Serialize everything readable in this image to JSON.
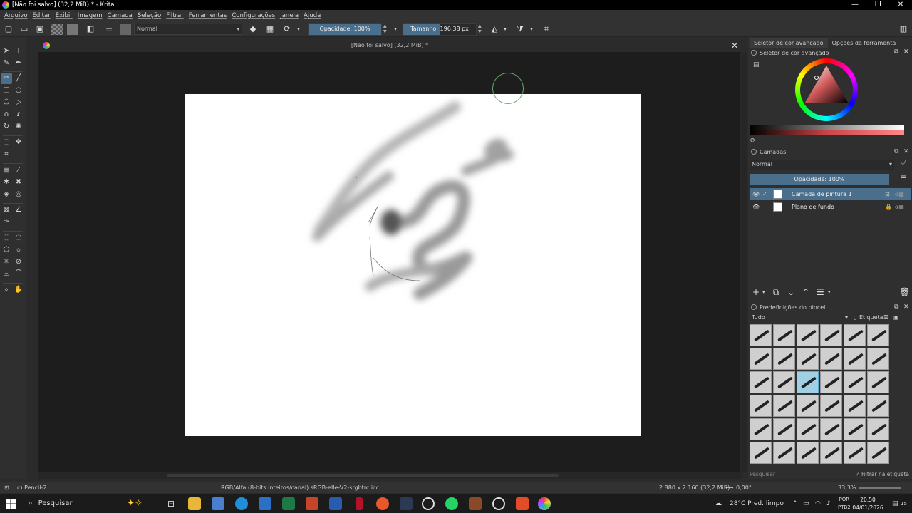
{
  "window": {
    "title": "[Não foi salvo]  (32,2 MiB) * - Krita",
    "controls": [
      "minimize",
      "maximize",
      "close"
    ]
  },
  "menu": [
    "Arquivo",
    "Editar",
    "Exibir",
    "Imagem",
    "Camada",
    "Seleção",
    "Filtrar",
    "Ferramentas",
    "Configurações",
    "Janela",
    "Ajuda"
  ],
  "toolbar": {
    "blend_mode": "Normal",
    "opacity": "Opacidade: 100%",
    "opacity_level": 1.0,
    "size": "Tamanho: 196,38 px",
    "size_level": 0.5
  },
  "document": {
    "tab_title": "[Não foi salvo]  (32,2 MiB) *"
  },
  "dock": {
    "tabs": [
      "Seletor de cor avançado",
      "Opções da ferramenta"
    ],
    "active_tab": "Seletor de cor avançado",
    "color_panel_title": "Seletor de cor avançado",
    "layers_title": "Camadas",
    "layer_blend_mode": "Normal",
    "layer_opacity": "Opacidade:  100%",
    "layers": [
      {
        "name": "Camada de pintura 1",
        "selected": true
      },
      {
        "name": "Plano de fundo",
        "selected": false
      }
    ],
    "brush_presets_title": "Predefinições do pincel",
    "brush_tag": "Tudo",
    "brush_tag_label": "Etiqueta",
    "brush_search_placeholder": "Pesquisar",
    "brush_filter_label": "Filtrar na etiqueta"
  },
  "status": {
    "tool": "c) Pencil-2",
    "color_space": "RGB/Alfa (8-bits inteiros/canal)  sRGB-elle-V2-srgbtrc.icc",
    "image_size": "2.880 x 2.160 (32,2 MiB)",
    "rotation": "0,00°",
    "zoom": "33,3%"
  },
  "taskbar": {
    "search_label": "Pesquisar",
    "weather": "28°C  Pred. limpo",
    "lang": "POR",
    "lang_sub": "PTB2",
    "time": "20:50",
    "date": "04/01/2026",
    "notifications": "15"
  },
  "colors": {
    "accent": "#4a6f8c",
    "brush_selected": "#9fd0e6",
    "cursor_ring": "#6aaa66"
  }
}
